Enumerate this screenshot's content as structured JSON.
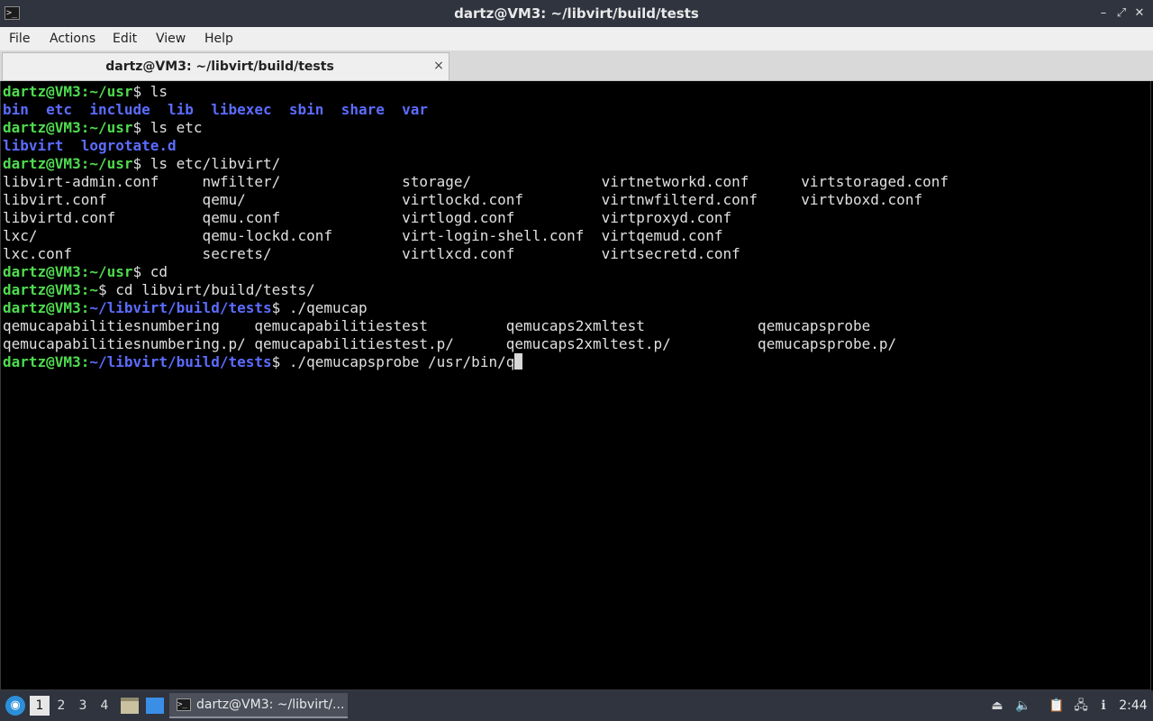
{
  "window": {
    "title": "dartz@VM3: ~/libvirt/build/tests",
    "icon": "terminal-icon",
    "controls": {
      "minimize": "–",
      "maximize": "⤢",
      "close": "✕"
    }
  },
  "menubar": {
    "items": [
      "File",
      "Actions",
      "Edit",
      "View",
      "Help"
    ]
  },
  "tabs": [
    {
      "label": "dartz@VM3: ~/libvirt/build/tests",
      "close": "×"
    }
  ],
  "terminal": {
    "colors": {
      "prompt": "#4fdc4f",
      "dir": "#5c6cff",
      "text": "#e0e0e0",
      "background": "#000000"
    },
    "lines": [
      [
        {
          "t": "dartz@VM3:~/usr",
          "c": "p"
        },
        {
          "t": "$ ls",
          "c": "t"
        }
      ],
      [
        {
          "t": "bin  etc  include  lib  libexec  sbin  share  var",
          "c": "d"
        }
      ],
      [
        {
          "t": "dartz@VM3:~/usr",
          "c": "p"
        },
        {
          "t": "$ ls etc",
          "c": "t"
        }
      ],
      [
        {
          "t": "libvirt  logrotate.d",
          "c": "d"
        }
      ],
      [
        {
          "t": "dartz@VM3:~/usr",
          "c": "p"
        },
        {
          "t": "$ ls etc/libvirt/",
          "c": "t"
        }
      ],
      [
        {
          "t": "libvirt-admin.conf     nwfilter/              storage/               virtnetworkd.conf      virtstoraged.conf",
          "c": "t"
        }
      ],
      [
        {
          "t": "libvirt.conf           qemu/                  virtlockd.conf         virtnwfilterd.conf     virtvboxd.conf",
          "c": "t"
        }
      ],
      [
        {
          "t": "libvirtd.conf          qemu.conf              virtlogd.conf          virtproxyd.conf",
          "c": "t"
        }
      ],
      [
        {
          "t": "lxc/                   qemu-lockd.conf        virt-login-shell.conf  virtqemud.conf",
          "c": "t"
        }
      ],
      [
        {
          "t": "lxc.conf               secrets/               virtlxcd.conf          virtsecretd.conf",
          "c": "t"
        }
      ],
      [
        {
          "t": "dartz@VM3:~/usr",
          "c": "p"
        },
        {
          "t": "$ cd",
          "c": "t"
        }
      ],
      [
        {
          "t": "dartz@VM3:~",
          "c": "p"
        },
        {
          "t": "$ cd libvirt/build/tests/",
          "c": "t"
        }
      ],
      [
        {
          "t": "dartz@VM3:",
          "c": "p"
        },
        {
          "t": "~/libvirt/build/tests",
          "c": "d"
        },
        {
          "t": "$ ./qemucap",
          "c": "t"
        }
      ],
      [
        {
          "t": "qemucapabilitiesnumbering    qemucapabilitiestest         qemucaps2xmltest             qemucapsprobe",
          "c": "t"
        }
      ],
      [
        {
          "t": "qemucapabilitiesnumbering.p/ qemucapabilitiestest.p/      qemucaps2xmltest.p/          qemucapsprobe.p/",
          "c": "t"
        }
      ],
      [
        {
          "t": "dartz@VM3:",
          "c": "p"
        },
        {
          "t": "~/libvirt/build/tests",
          "c": "d"
        },
        {
          "t": "$ ./qemucapsprobe /usr/bin/q",
          "c": "t"
        }
      ]
    ]
  },
  "taskbar": {
    "start_icon": "start-menu-icon",
    "workspaces": [
      "1",
      "2",
      "3",
      "4"
    ],
    "active_workspace": "1",
    "quicklaunch": [
      "file-manager-icon",
      "show-desktop-icon"
    ],
    "task": {
      "label": "dartz@VM3: ~/libvirt/...",
      "icon": "terminal-icon"
    },
    "tray": [
      "upload-icon",
      "volume-icon",
      "clipboard-icon",
      "network-icon",
      "notification-icon"
    ],
    "clock": "2:44"
  }
}
